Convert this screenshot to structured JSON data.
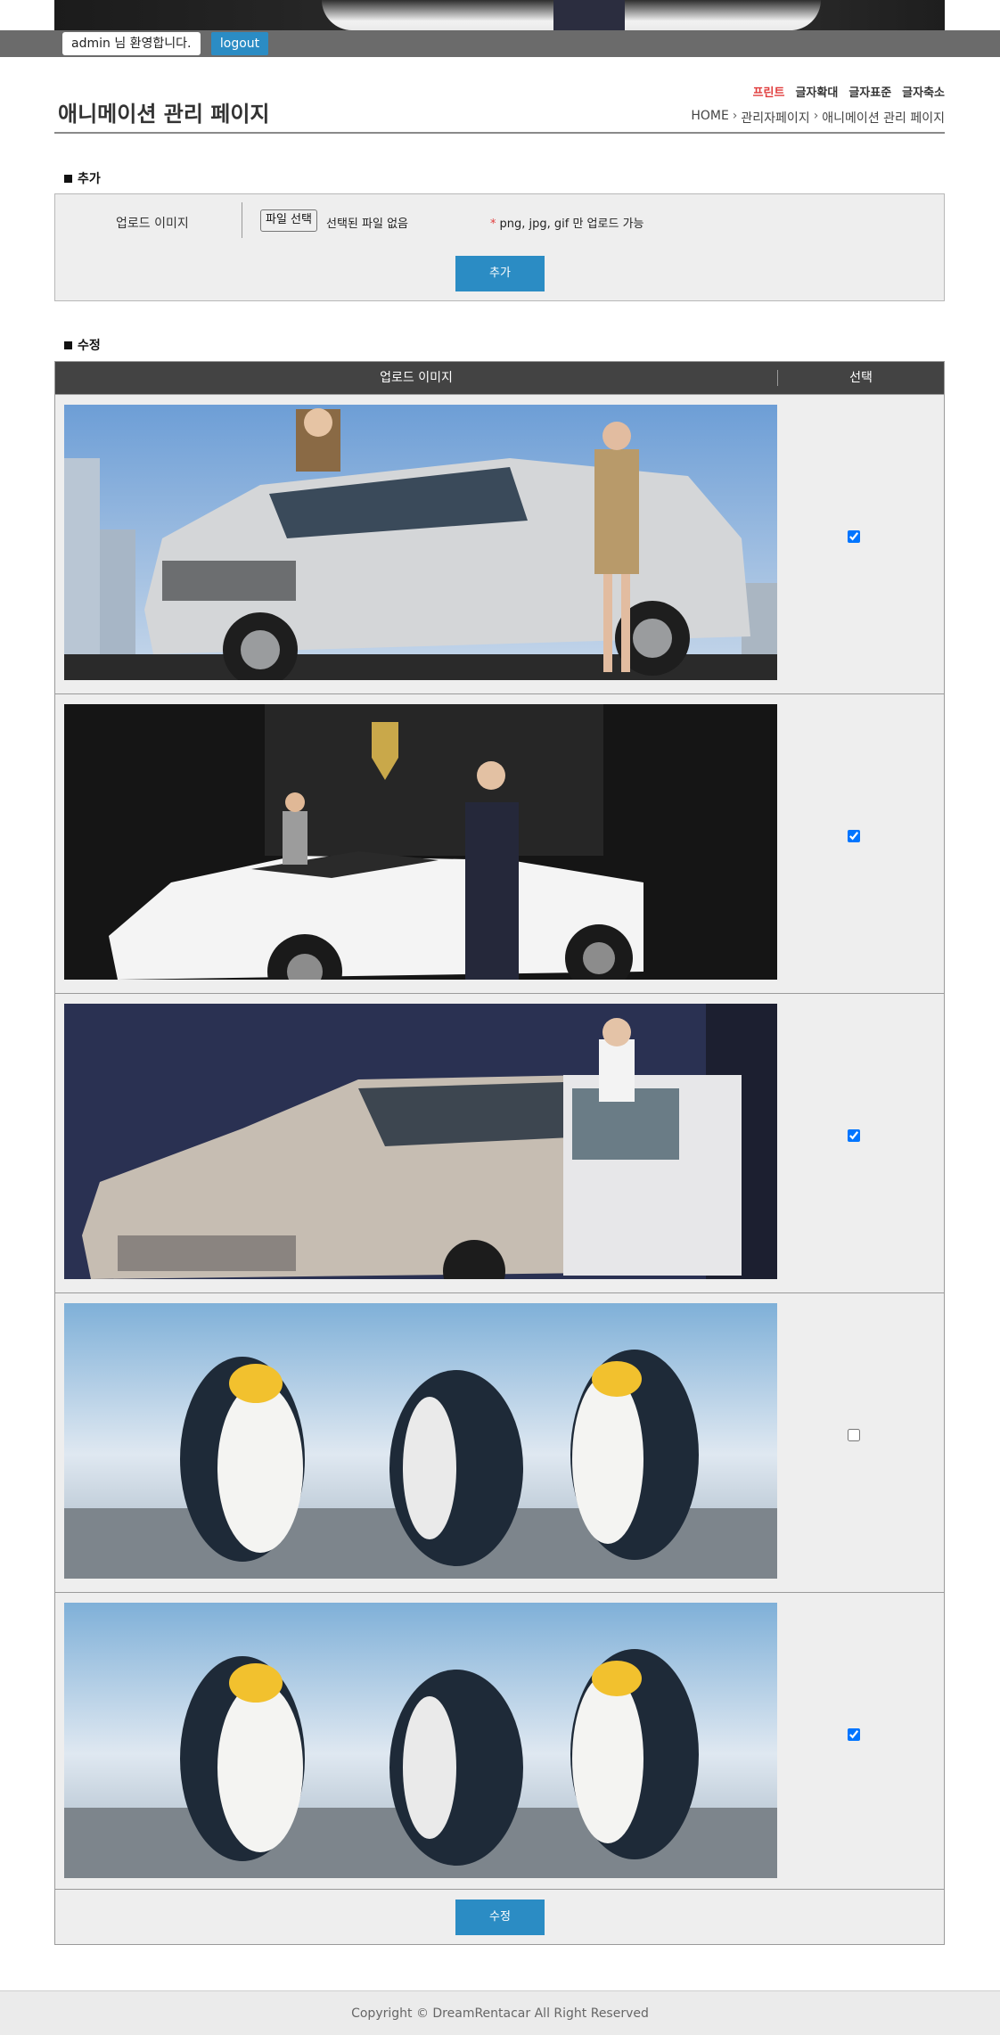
{
  "admin": {
    "welcome": "admin 님 환영합니다.",
    "logout_label": "logout"
  },
  "header": {
    "title": "애니메이션 관리 페이지",
    "utils": [
      "프린트",
      "글자확대",
      "글자표준",
      "글자축소"
    ],
    "breadcrumb": [
      "HOME",
      "관리자페이지",
      "애니메이션 관리 페이지"
    ]
  },
  "add_section": {
    "title": "추가",
    "upload_label": "업로드 이미지",
    "file_button": "파일 선택",
    "file_status": "선택된 파일 없음",
    "note": "png, jpg, gif 만 업로드 가능",
    "submit_label": "추가"
  },
  "edit_section": {
    "title": "수정",
    "columns": [
      "업로드 이미지",
      "선택"
    ],
    "rows": [
      {
        "image": "ford-explorer-suv",
        "checked": true
      },
      {
        "image": "lamborghini-showroom",
        "checked": true
      },
      {
        "image": "peugeot-208",
        "checked": true
      },
      {
        "image": "penguins",
        "checked": false
      },
      {
        "image": "penguins",
        "checked": true
      }
    ],
    "submit_label": "수정"
  },
  "footer": {
    "copyright": "Copyright © DreamRentacar All Right Reserved"
  },
  "colors": {
    "accent": "#2b8cc4",
    "print_red": "#e03c3c",
    "table_header": "#434343",
    "admin_bar": "#6b6b6b"
  }
}
